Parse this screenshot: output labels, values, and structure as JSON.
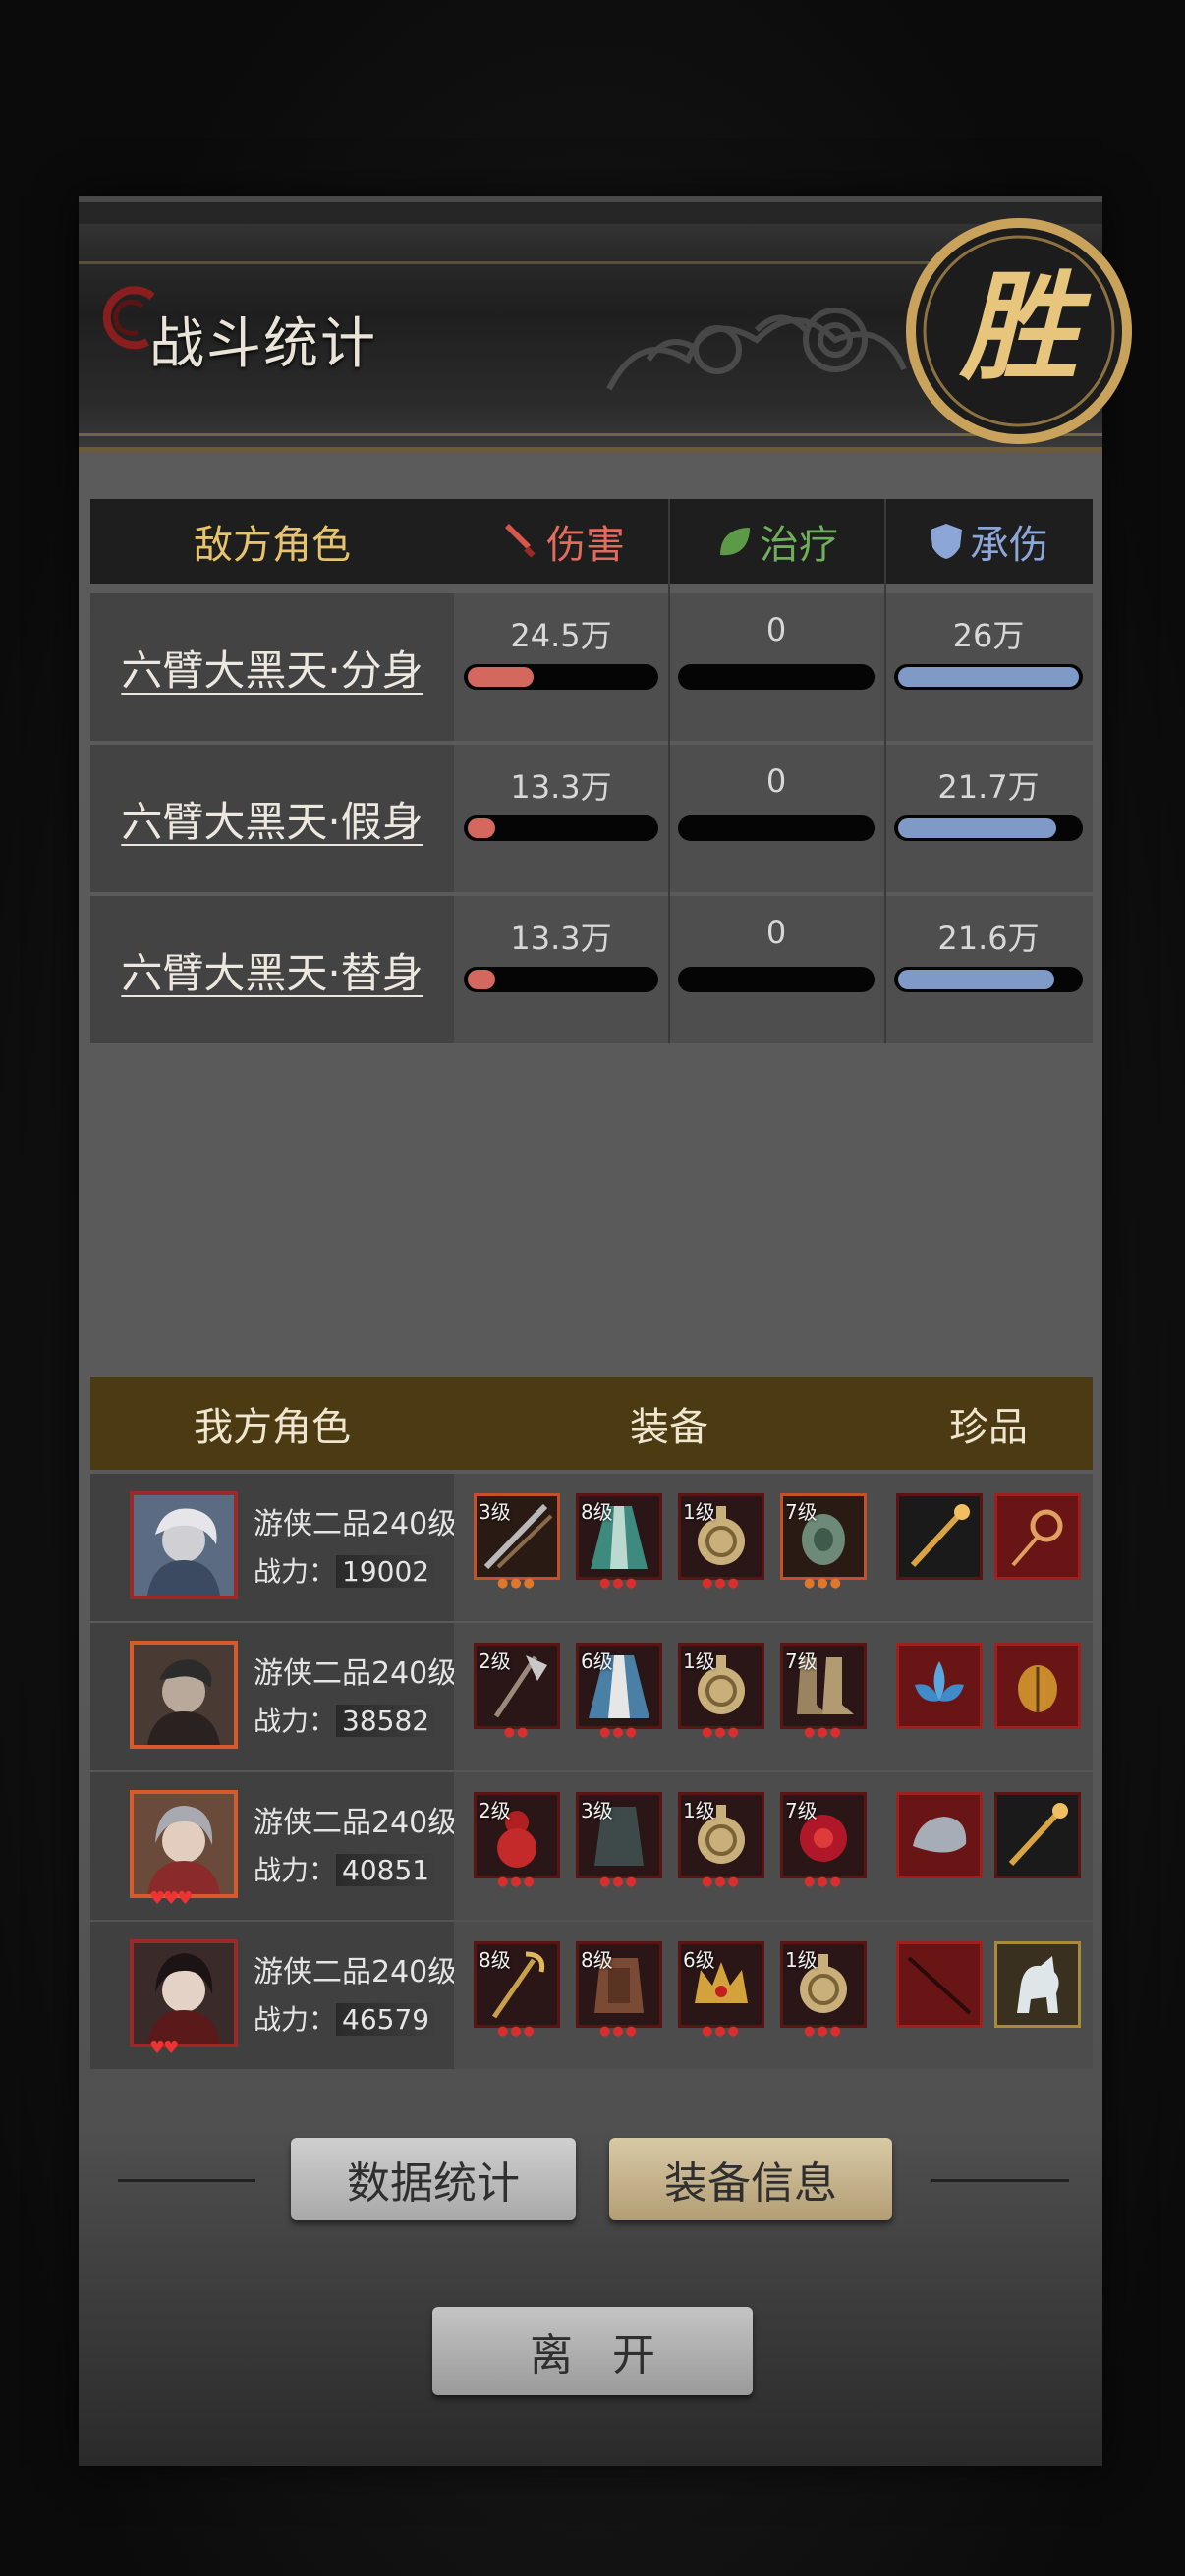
{
  "header": {
    "title": "战斗统计",
    "seal_char": "胜"
  },
  "enemy_table": {
    "headers": {
      "role": "敌方角色",
      "damage": "伤害",
      "heal": "治疗",
      "tank": "承伤"
    },
    "rows": [
      {
        "name": "六臂大黑天·分身",
        "damage": "24.5万",
        "heal": "0",
        "tank": "26万",
        "damage_ratio": 0.34,
        "heal_ratio": 0,
        "tank_ratio": 1.0
      },
      {
        "name": "六臂大黑天·假身",
        "damage": "13.3万",
        "heal": "0",
        "tank": "21.7万",
        "damage_ratio": 0.14,
        "heal_ratio": 0,
        "tank_ratio": 0.84
      },
      {
        "name": "六臂大黑天·替身",
        "damage": "13.3万",
        "heal": "0",
        "tank": "21.6万",
        "damage_ratio": 0.14,
        "heal_ratio": 0,
        "tank_ratio": 0.83
      }
    ]
  },
  "our_table": {
    "headers": {
      "role": "我方角色",
      "equip": "装备",
      "treasure": "珍品"
    },
    "rows": [
      {
        "class": "游侠二品240级",
        "power_label": "战力：",
        "power": "19002",
        "equips": [
          {
            "level": "3级",
            "icon": "spear-icon"
          },
          {
            "level": "8级",
            "icon": "robe-icon"
          },
          {
            "level": "1级",
            "icon": "knot-icon"
          },
          {
            "level": "7级",
            "icon": "jade-icon"
          }
        ],
        "treasures": [
          {
            "icon": "brush-icon"
          },
          {
            "icon": "hairpin-icon"
          }
        ]
      },
      {
        "class": "游侠二品240级",
        "power_label": "战力：",
        "power": "38582",
        "equips": [
          {
            "level": "2级",
            "icon": "axe-icon"
          },
          {
            "level": "6级",
            "icon": "robe-icon"
          },
          {
            "level": "1级",
            "icon": "knot-icon"
          },
          {
            "level": "7级",
            "icon": "boots-icon"
          }
        ],
        "treasures": [
          {
            "icon": "lotus-icon"
          },
          {
            "icon": "beetle-icon"
          }
        ]
      },
      {
        "class": "游侠二品240级",
        "power_label": "战力：",
        "power": "40851",
        "equips": [
          {
            "level": "2级",
            "icon": "gourd-icon"
          },
          {
            "level": "3级",
            "icon": "cloak-icon"
          },
          {
            "level": "1级",
            "icon": "knot-icon"
          },
          {
            "level": "7级",
            "icon": "flower-icon"
          }
        ],
        "treasures": [
          {
            "icon": "stone-icon"
          },
          {
            "icon": "brush-icon"
          }
        ]
      },
      {
        "class": "游侠二品240级",
        "power_label": "战力：",
        "power": "46579",
        "equips": [
          {
            "level": "8级",
            "icon": "staff-icon"
          },
          {
            "level": "8级",
            "icon": "armor-icon"
          },
          {
            "level": "6级",
            "icon": "crown-icon"
          },
          {
            "level": "1级",
            "icon": "knot-icon"
          }
        ],
        "treasures": [
          {
            "icon": "rod-icon"
          },
          {
            "icon": "qilin-icon"
          }
        ]
      }
    ]
  },
  "buttons": {
    "stats": "数据统计",
    "equip_info": "装备信息",
    "leave": "离开"
  },
  "colors": {
    "damage": "#e06b5e",
    "heal": "#5fb06a",
    "tank": "#8ca6d8",
    "gold": "#e6c36e",
    "panel": "#5a5a5a"
  }
}
